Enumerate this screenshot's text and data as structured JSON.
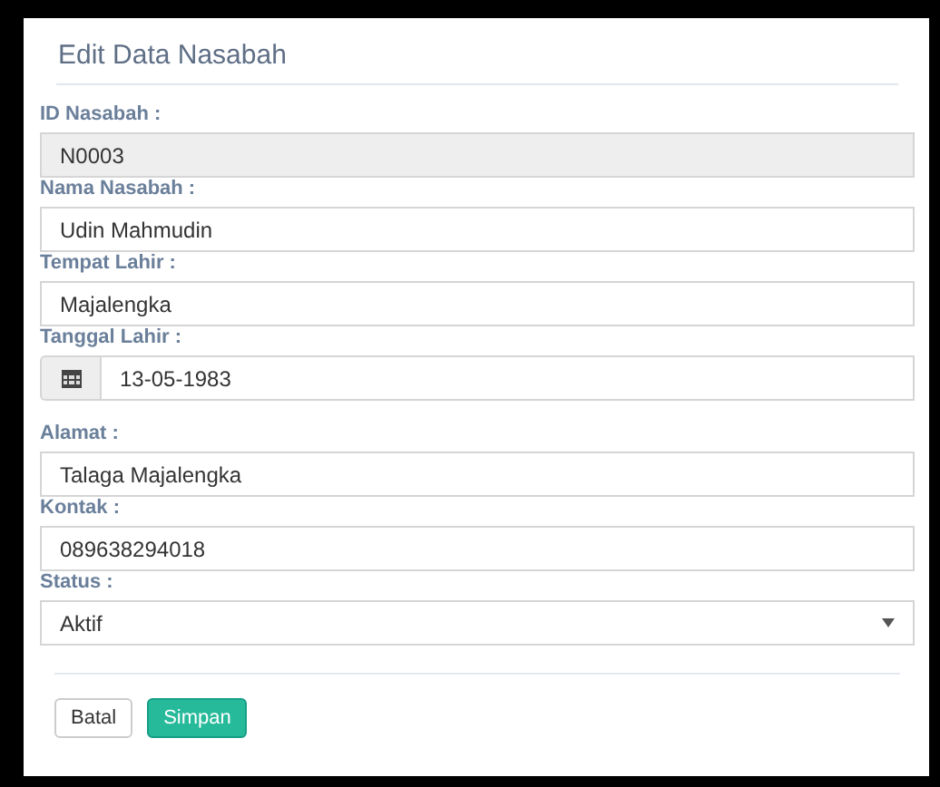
{
  "title": "Edit Data Nasabah",
  "fields": [
    {
      "label": "ID Nasabah :",
      "kind": "text",
      "value": "N0003",
      "disabled": true
    },
    {
      "label": "Nama Nasabah :",
      "kind": "text",
      "value": "Udin Mahmudin",
      "disabled": false
    },
    {
      "label": "Tempat Lahir :",
      "kind": "text",
      "value": "Majalengka",
      "disabled": false
    },
    {
      "label": "Tanggal Lahir :",
      "kind": "date",
      "value": "13-05-1983",
      "disabled": false
    },
    {
      "label": "Alamat :",
      "kind": "text",
      "value": "Talaga Majalengka",
      "disabled": false
    },
    {
      "label": "Kontak :",
      "kind": "text",
      "value": "089638294018",
      "disabled": false
    },
    {
      "label": "Status :",
      "kind": "select",
      "value": "Aktif",
      "disabled": false
    }
  ],
  "buttons": [
    {
      "label": "Batal",
      "kind": "default"
    },
    {
      "label": "Simpan",
      "kind": "primary"
    }
  ]
}
